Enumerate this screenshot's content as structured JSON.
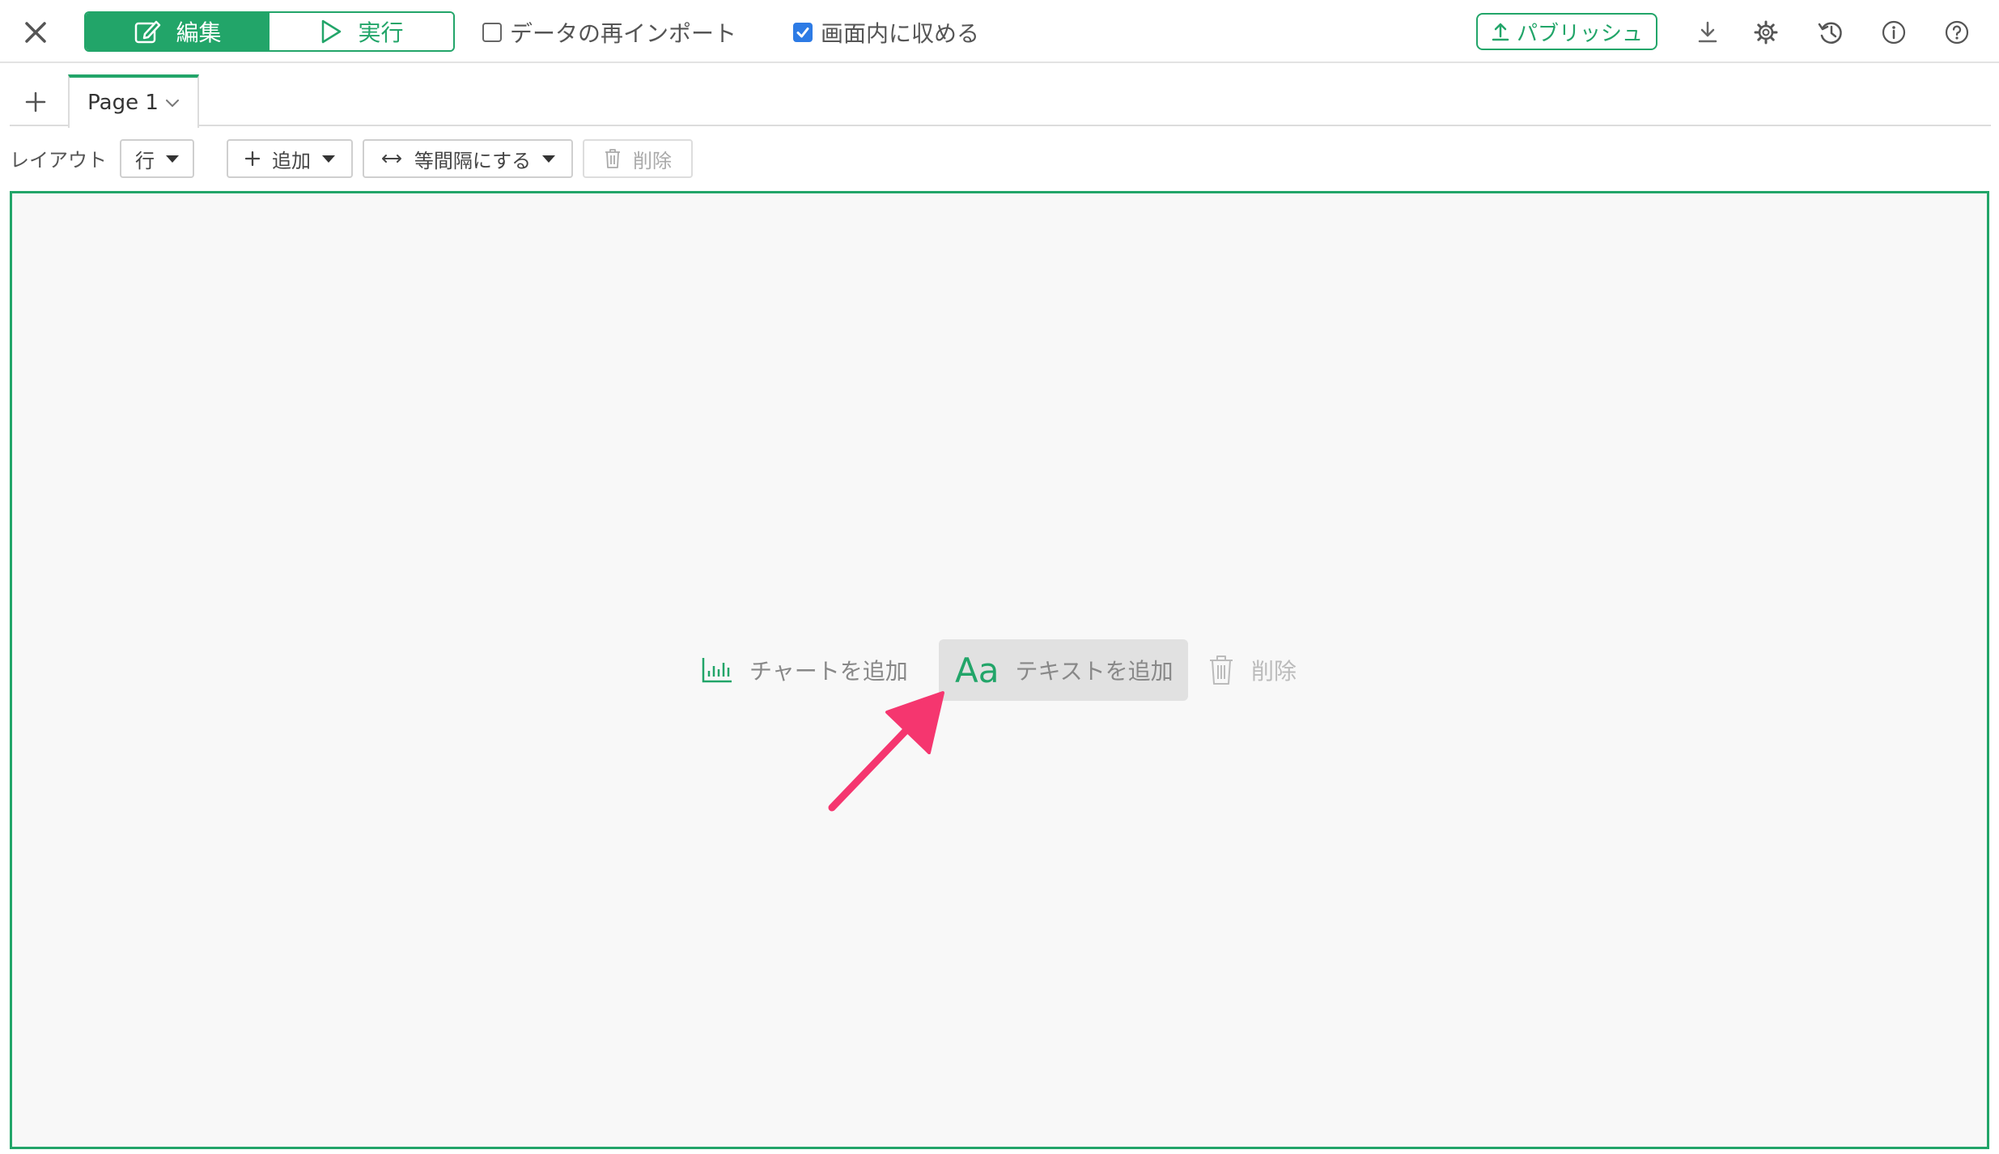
{
  "toolbar": {
    "edit_label": "編集",
    "run_label": "実行",
    "reimport_label": "データの再インポート",
    "reimport_checked": false,
    "fit_label": "画面内に収める",
    "fit_checked": true,
    "publish_label": "パブリッシュ",
    "icons": [
      "close-icon",
      "edit-icon",
      "play-icon",
      "upload-icon",
      "download-icon",
      "gear-icon",
      "history-icon",
      "info-icon",
      "help-icon"
    ]
  },
  "tabs": {
    "add_icon": "plus-icon",
    "items": [
      {
        "label": "Page 1",
        "active": true
      }
    ]
  },
  "layout_bar": {
    "layout_label": "レイアウト",
    "layout_value": "行",
    "add_label": "追加",
    "spacing_label": "等間隔にする",
    "delete_label": "削除"
  },
  "canvas": {
    "add_chart_label": "チャートを追加",
    "add_text_label": "テキストを追加",
    "text_icon_glyph": "Aa",
    "delete_label": "削除"
  },
  "colors": {
    "accent": "#22a569",
    "checkbox": "#2d7be5",
    "arrow": "#f5366f",
    "canvas_bg": "#f8f8f8"
  }
}
